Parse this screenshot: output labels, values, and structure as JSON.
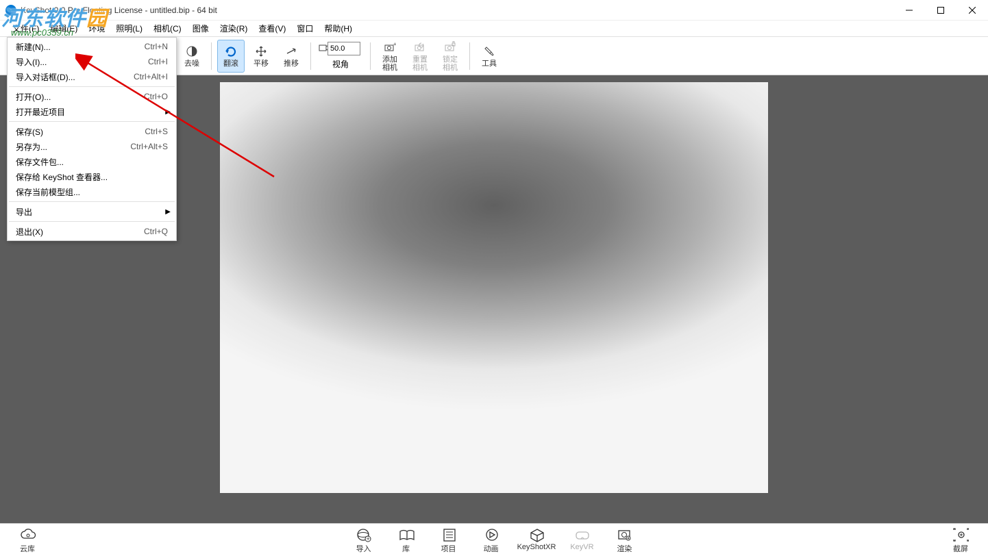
{
  "title": "KeyShot 9.0 Pro Floating License  - untitled.bip  - 64 bit",
  "watermark": {
    "main_pre": "河东软件",
    "main_o": "园",
    "sub": "www.pc0359.cn"
  },
  "menubar": [
    "文件(F)",
    "编辑(E)",
    "环境",
    "照明(L)",
    "相机(C)",
    "图像",
    "渲染(R)",
    "查看(V)",
    "窗口",
    "帮助(H)"
  ],
  "toolbar": {
    "denoise": "去噪",
    "tumble": "翻滚",
    "pan": "平移",
    "dolly": "推移",
    "fov": "视角",
    "fov_value": "50.0",
    "add_cam": "添加\n相机",
    "reset_cam": "重置\n相机",
    "lock_cam": "锁定\n相机",
    "tools": "工具"
  },
  "dropdown": [
    {
      "type": "item",
      "label": "新建(N)...",
      "shortcut": "Ctrl+N"
    },
    {
      "type": "item",
      "label": "导入(I)...",
      "shortcut": "Ctrl+I"
    },
    {
      "type": "item",
      "label": "导入对话框(D)...",
      "shortcut": "Ctrl+Alt+I"
    },
    {
      "type": "sep"
    },
    {
      "type": "item",
      "label": "打开(O)...",
      "shortcut": "Ctrl+O"
    },
    {
      "type": "item",
      "label": "打开最近项目",
      "submenu": true
    },
    {
      "type": "sep"
    },
    {
      "type": "item",
      "label": "保存(S)",
      "shortcut": "Ctrl+S"
    },
    {
      "type": "item",
      "label": "另存为...",
      "shortcut": "Ctrl+Alt+S"
    },
    {
      "type": "item",
      "label": "保存文件包..."
    },
    {
      "type": "item",
      "label": "保存给 KeyShot 查看器..."
    },
    {
      "type": "item",
      "label": "保存当前模型组..."
    },
    {
      "type": "sep"
    },
    {
      "type": "item",
      "label": "导出",
      "submenu": true
    },
    {
      "type": "sep"
    },
    {
      "type": "item",
      "label": "退出(X)",
      "shortcut": "Ctrl+Q"
    }
  ],
  "bottombar": {
    "cloud": "云库",
    "import": "导入",
    "library": "库",
    "project": "项目",
    "anim": "动画",
    "xr": "KeyShotXR",
    "vr": "KeyVR",
    "render": "渲染",
    "screenshot": "截屏"
  }
}
